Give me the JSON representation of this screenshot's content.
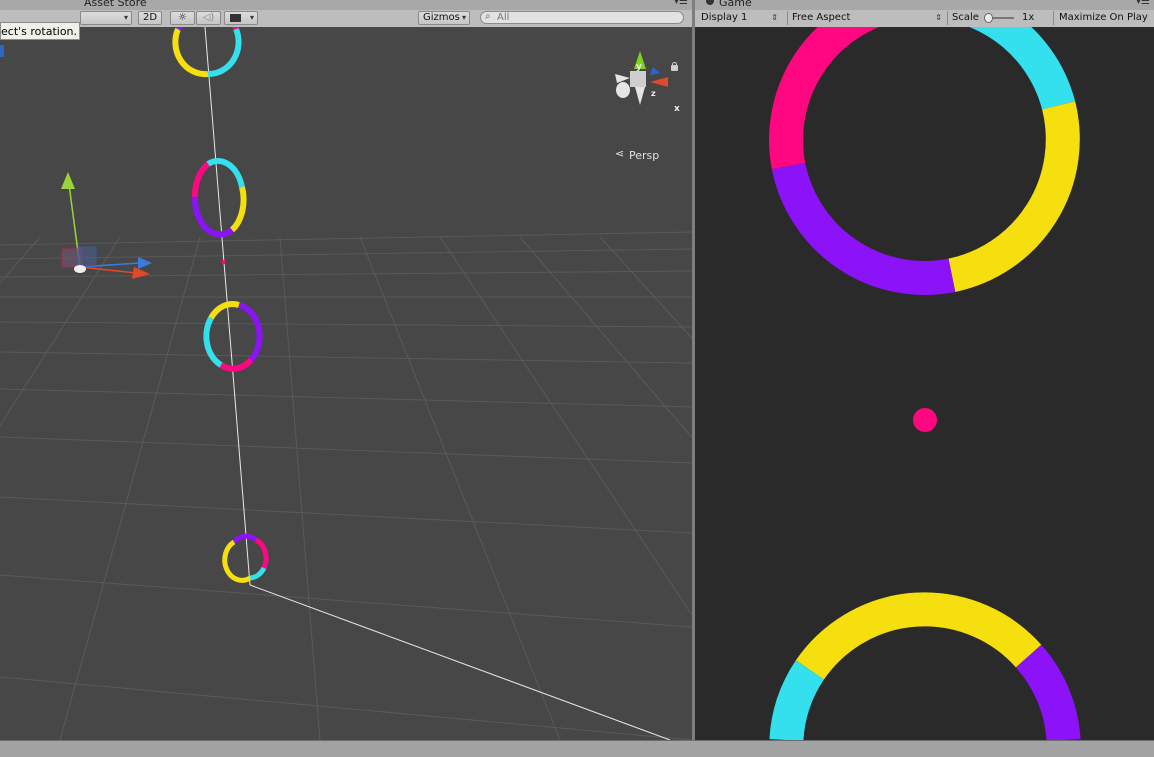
{
  "scene": {
    "tab_label": "Asset Store",
    "tooltip": "ect's rotation.",
    "toolbar": {
      "mode_2d": "2D",
      "gizmos_label": "Gizmos",
      "search_placeholder": "All"
    },
    "persp_label": "Persp",
    "axis_labels": {
      "y": "y",
      "x": "x",
      "z": "z"
    }
  },
  "game": {
    "tab_label": "Game",
    "display": "Display 1",
    "aspect": "Free Aspect",
    "scale_label": "Scale",
    "scale_value": "1x",
    "maximize_label": "Maximize On Play"
  },
  "colors": {
    "cyan": "#34e0ee",
    "yellow": "#f5df0f",
    "magenta": "#ff0780",
    "purple": "#8c12f7",
    "game_bg": "#2a2a2a",
    "scene_bg": "#474747"
  }
}
